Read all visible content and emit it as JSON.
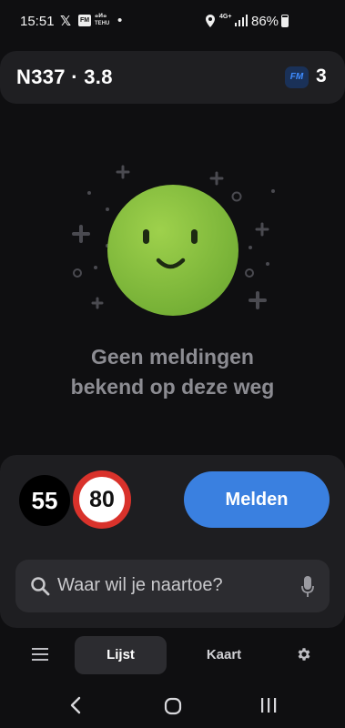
{
  "status_bar": {
    "time": "15:51",
    "x_label": "𝕏",
    "fm_label": "FM",
    "tehu_label": "ⴰⵍⴰ\nTEHU",
    "dot": "•",
    "network": "4G+",
    "battery": "86%"
  },
  "header": {
    "road": "N337 · 3.8",
    "fm_badge": "FM",
    "fm_count": "3"
  },
  "empty_state": {
    "line1": "Geen meldingen",
    "line2": "bekend op deze weg"
  },
  "speed": {
    "current": "55",
    "limit": "80"
  },
  "report_button": "Melden",
  "search": {
    "placeholder": "Waar wil je naartoe?"
  },
  "tabs": {
    "list": "Lijst",
    "map": "Kaart"
  },
  "colors": {
    "accent": "#3a80e0",
    "smiley": "#8ac43f",
    "limit_ring": "#d9322b"
  }
}
